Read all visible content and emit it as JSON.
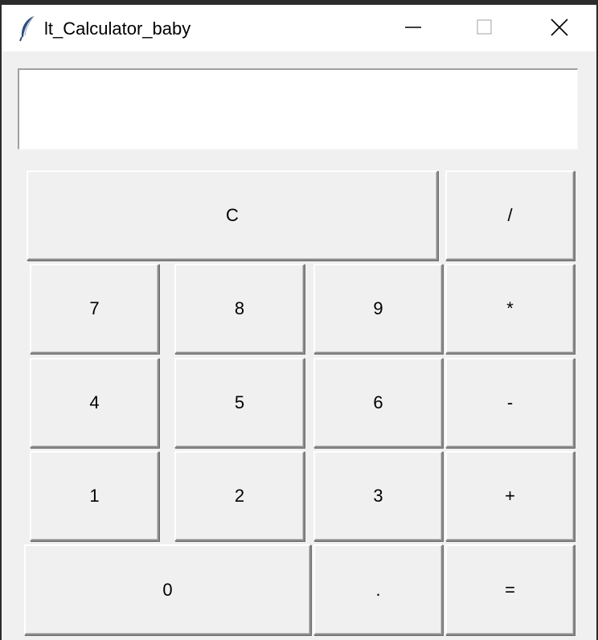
{
  "window": {
    "title": "lt_Calculator_baby"
  },
  "display": {
    "value": ""
  },
  "keys": {
    "clear": "C",
    "divide": "/",
    "seven": "7",
    "eight": "8",
    "nine": "9",
    "multiply": "*",
    "four": "4",
    "five": "5",
    "six": "6",
    "minus": "-",
    "one": "1",
    "two": "2",
    "three": "3",
    "plus": "+",
    "zero": "0",
    "dot": ".",
    "equals": "="
  },
  "icons": {
    "app": "feather-icon",
    "minimize": "minimize-icon",
    "maximize": "maximize-icon",
    "close": "close-icon"
  },
  "colors": {
    "window_bg": "#f0f0f0",
    "titlebar_bg": "#ffffff",
    "display_bg": "#ffffff"
  }
}
